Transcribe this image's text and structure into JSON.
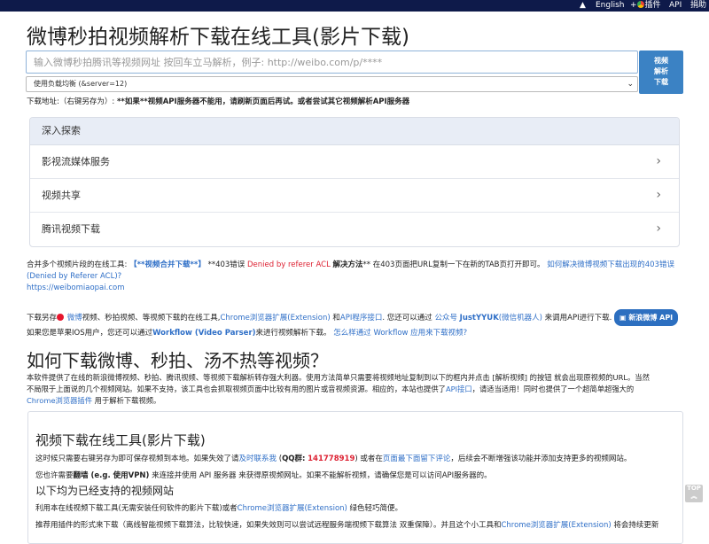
{
  "topbar": {
    "up_arrow": "▲",
    "english": "English",
    "plugin_prefix": "+",
    "plugin_label": "插件",
    "api": "API",
    "donate": "捐助"
  },
  "title": "微博秒拍视频解析下载在线工具(影片下载)",
  "search": {
    "placeholder": "输入微博秒拍腾讯等视频网址 按回车立马解析，例子: http://weibo.com/p/****"
  },
  "server_select": {
    "selected": "使用负载均衡 (&server=12)",
    "chevron": "⌄"
  },
  "parse_button": {
    "line1": "视频",
    "line2": "解析",
    "line3": "下载"
  },
  "download_address": {
    "label": "下载地址:（右键另存为）:",
    "note": "**如果**视频API服务器不能用，请刷新页面后再试。或者尝试其它视频解析API服务器"
  },
  "explore": {
    "heading": "深入探索",
    "items": [
      {
        "label": "影视流媒体服务"
      },
      {
        "label": "视频共享"
      },
      {
        "label": "腾讯视频下载"
      }
    ],
    "chevron": "›"
  },
  "merge": {
    "prefix": "合并多个视频片段的在线工具:",
    "link": "【**视频合并下载**】",
    "err_prefix": "**403错误",
    "err_red": "Denied by referer ACL",
    "solution_label": "解决方法",
    "solution_text": "** 在403页面把URL复制一下在新的TAB页打开即可。",
    "link2": "如何解决微博视频下载出现的403错误",
    "link2b": "(Denied by Referer ACL)?",
    "link3": "https://weibomiaopai.com"
  },
  "intro": {
    "t1": "下载另存",
    "weibo_link": "微博",
    "t2": "视频、秒拍视频、等视频下载的在线工具,",
    "chrome_link": "Chrome浏览器扩展(Extension)",
    "t3": "和",
    "api_link": "API程序接口",
    "t4": ". 您还可以通过",
    "gzh_link": "公众号",
    "bot_link": "JustYYUK",
    "bot_suffix": "(微信机器人)",
    "t5": "来调用API进行下载.",
    "badge": "新浪微博 API",
    "ios_t1": "如果您是苹果IOS用户，您还可以通过",
    "workflow_link": "Workflow (Video Parser)",
    "ios_t2": "来进行视频解析下载。",
    "workflow_link2": "怎么样通过 Workflow 应用来下载视频?"
  },
  "howto": {
    "heading": "如何下载微博、秒拍、汤不热等视频？",
    "p1": "本软件提供了在线的新浪微博视频、秒拍、腾讯视频、等视频下载解析转存强大利器。使用方法简单只需要将视频地址复制到以下的框内并点击 [解析视频] 的按钮 就会出现原视频的URL。当然",
    "p2": "不局限于上面说的几个视频网站。如果不支持，该工具也会抓取视频页面中比较有用的图片或音视频资源。相应的，本站也提供了",
    "p2_link": "API接口",
    "p2b": "，请适当适用！同时也提供了一个超简单超强大的",
    "p3_link": "Chrome浏览器插件",
    "p3": "用于解析下载视频。"
  },
  "card": {
    "title": "视频下载在线工具(影片下载)",
    "p1a": "这时候只需要右键另存为即可保存视频到本地。如果失效了请",
    "p1_link": "及时联系我",
    "p1b": "(",
    "p1_qq_label": "QQ群:",
    "p1_qq": "141778919",
    "p1c": ") 或者在",
    "p1_link2": "页面最下面留下评论",
    "p1d": "，后续会不断增强该功能并添加支持更多的视频网站。",
    "p2a": "您也许需要",
    "p2_bold": "翻墙 (e.g. 使用VPN)",
    "p2b": "来连接并使用 API 服务器 来获得原视频网址。如果不能解析视频，请确保您是可以访问API服务器的。",
    "h3": "以下均为已经支持的视频网站",
    "p3a": "利用本在线视频下载工具(无需安装任何软件的影片下载)或者",
    "p3_link": "Chrome浏览器扩展(Extension)",
    "p3b": "绿色轻巧简便。",
    "p4a": "推荐用插件的形式来下载（离线智能视频下载算法，比较快速，如果失效则可以尝试远程服务端视频下载算法 双重保障）。并且这个小工具和",
    "p4_link": "Chrome浏览器扩展(Extension)",
    "p4b": "将会持续更新"
  },
  "top_button": {
    "label": "TOP",
    "arrow": "︽"
  }
}
